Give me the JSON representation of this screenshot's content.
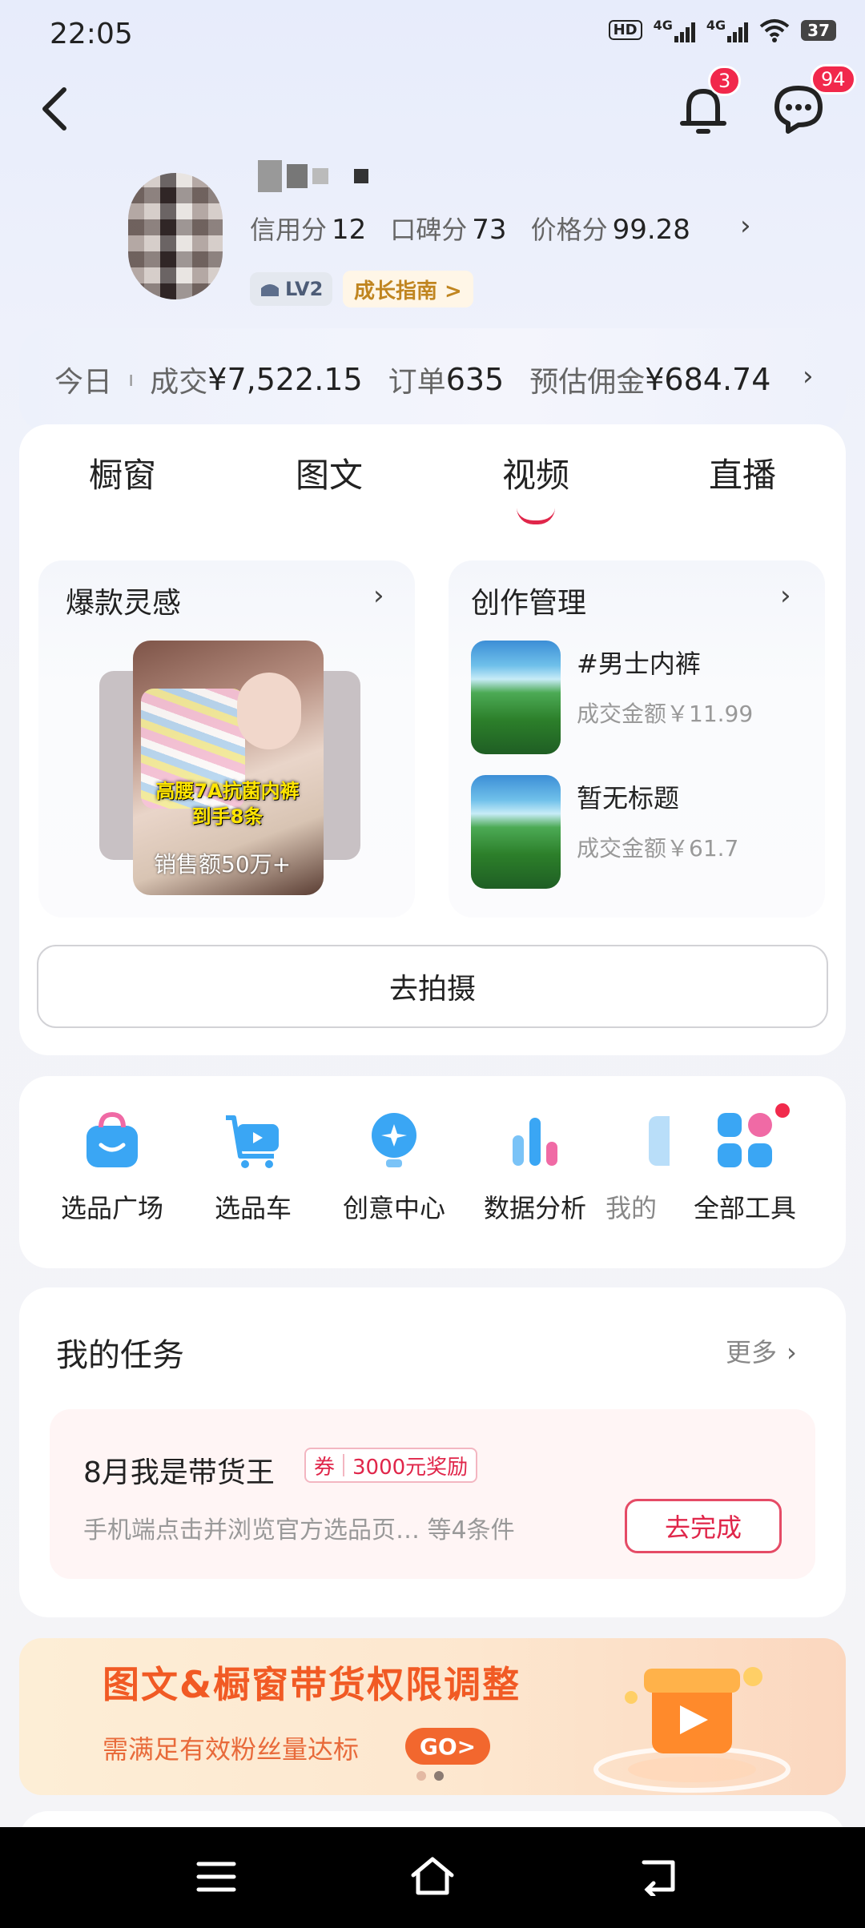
{
  "status": {
    "time": "22:05",
    "hd": "HD",
    "net1": "4G",
    "net2": "4G",
    "battery": "37"
  },
  "header": {
    "notifications_count": "3",
    "messages_count": "94"
  },
  "profile": {
    "scores": [
      {
        "label": "信用分",
        "value": "12"
      },
      {
        "label": "口碑分",
        "value": "73"
      },
      {
        "label": "价格分",
        "value": "99.28"
      }
    ],
    "level": "LV2",
    "growth_guide": "成长指南 >"
  },
  "today": {
    "label": "今日",
    "deal_label": "成交",
    "deal_value": "¥7,522.15",
    "orders_label": "订单",
    "orders_value": "635",
    "commission_label": "预估佣金",
    "commission_value": "¥684.74"
  },
  "tabs": [
    "橱窗",
    "图文",
    "视频",
    "直播"
  ],
  "active_tab": "视频",
  "inspiration": {
    "title": "爆款灵感",
    "caption_line1": "高腰7A抗菌内裤",
    "caption_line2": "到手8条",
    "sales": "销售额50万+"
  },
  "creation": {
    "title": "创作管理",
    "items": [
      {
        "title": "#男士内裤",
        "sub": "成交金额￥11.99"
      },
      {
        "title": "暂无标题",
        "sub": "成交金额￥61.7"
      }
    ]
  },
  "shoot_button": "去拍摄",
  "tools": [
    {
      "label": "选品广场",
      "icon": "bag-icon"
    },
    {
      "label": "选品车",
      "icon": "cart-icon"
    },
    {
      "label": "创意中心",
      "icon": "bulb-icon"
    },
    {
      "label": "数据分析",
      "icon": "bar-chart-icon"
    },
    {
      "label": "我的",
      "icon": "doc-icon"
    },
    {
      "label": "全部工具",
      "icon": "grid-icon"
    }
  ],
  "tasks": {
    "title": "我的任务",
    "more": "更多",
    "item": {
      "name": "8月我是带货王",
      "coupon_tag": "券",
      "reward": "3000元奖励",
      "desc": "手机端点击并浏览官方选品页…   等4条件",
      "action": "去完成"
    }
  },
  "banner": {
    "title": "图文&橱窗带货权限调整",
    "subtitle": "需满足有效粉丝量达标",
    "go": "GO>"
  },
  "colors": {
    "accent": "#e0264a",
    "badge": "#f1284b",
    "banner_orange": "#f15a24"
  }
}
